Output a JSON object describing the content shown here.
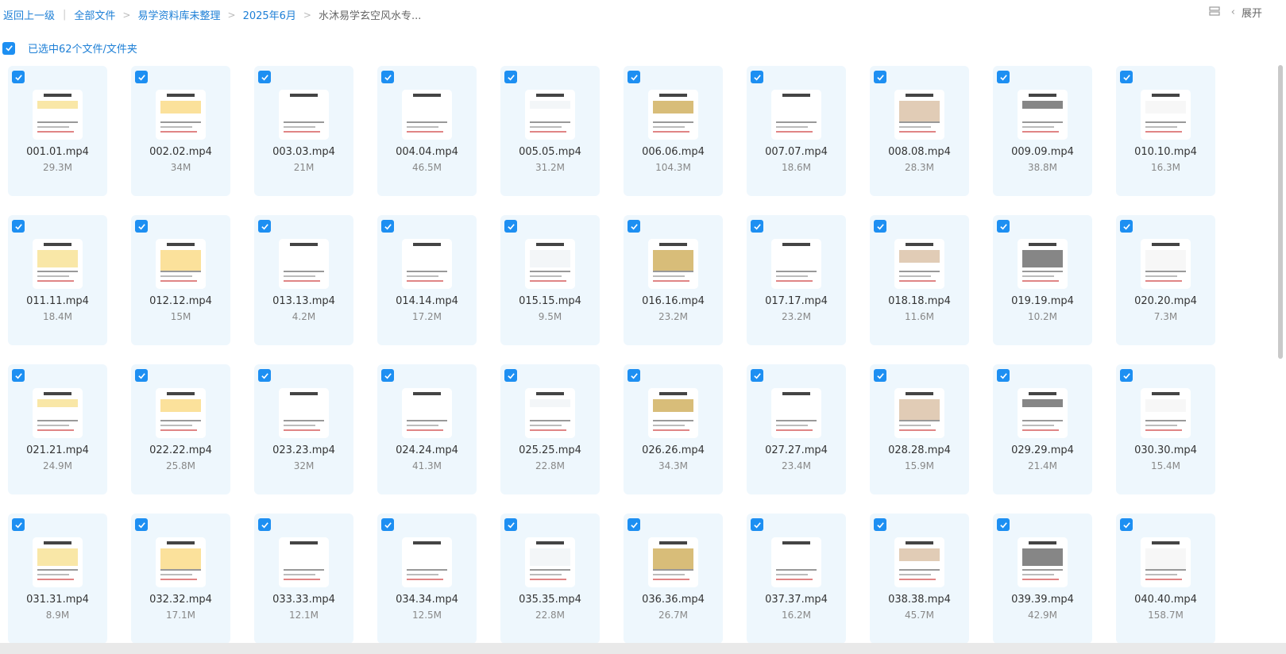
{
  "breadcrumb": {
    "back": "返回上一级",
    "items": [
      "全部文件",
      "易学资料库未整理",
      "2025年6月",
      "水沐易学玄空风水专..."
    ]
  },
  "toolbar": {
    "expand_label": "展开"
  },
  "selection": {
    "text": "已选中62个文件/文件夹"
  },
  "files": [
    {
      "name": "001.01.mp4",
      "size": "29.3M"
    },
    {
      "name": "002.02.mp4",
      "size": "34M"
    },
    {
      "name": "003.03.mp4",
      "size": "21M"
    },
    {
      "name": "004.04.mp4",
      "size": "46.5M"
    },
    {
      "name": "005.05.mp4",
      "size": "31.2M"
    },
    {
      "name": "006.06.mp4",
      "size": "104.3M"
    },
    {
      "name": "007.07.mp4",
      "size": "18.6M"
    },
    {
      "name": "008.08.mp4",
      "size": "28.3M"
    },
    {
      "name": "009.09.mp4",
      "size": "38.8M"
    },
    {
      "name": "010.10.mp4",
      "size": "16.3M"
    },
    {
      "name": "011.11.mp4",
      "size": "18.4M"
    },
    {
      "name": "012.12.mp4",
      "size": "15M"
    },
    {
      "name": "013.13.mp4",
      "size": "4.2M"
    },
    {
      "name": "014.14.mp4",
      "size": "17.2M"
    },
    {
      "name": "015.15.mp4",
      "size": "9.5M"
    },
    {
      "name": "016.16.mp4",
      "size": "23.2M"
    },
    {
      "name": "017.17.mp4",
      "size": "23.2M"
    },
    {
      "name": "018.18.mp4",
      "size": "11.6M"
    },
    {
      "name": "019.19.mp4",
      "size": "10.2M"
    },
    {
      "name": "020.20.mp4",
      "size": "7.3M"
    },
    {
      "name": "021.21.mp4",
      "size": "24.9M"
    },
    {
      "name": "022.22.mp4",
      "size": "25.8M"
    },
    {
      "name": "023.23.mp4",
      "size": "32M"
    },
    {
      "name": "024.24.mp4",
      "size": "41.3M"
    },
    {
      "name": "025.25.mp4",
      "size": "22.8M"
    },
    {
      "name": "026.26.mp4",
      "size": "34.3M"
    },
    {
      "name": "027.27.mp4",
      "size": "23.4M"
    },
    {
      "name": "028.28.mp4",
      "size": "15.9M"
    },
    {
      "name": "029.29.mp4",
      "size": "21.4M"
    },
    {
      "name": "030.30.mp4",
      "size": "15.4M"
    },
    {
      "name": "031.31.mp4",
      "size": "8.9M"
    },
    {
      "name": "032.32.mp4",
      "size": "17.1M"
    },
    {
      "name": "033.33.mp4",
      "size": "12.1M"
    },
    {
      "name": "034.34.mp4",
      "size": "12.5M"
    },
    {
      "name": "035.35.mp4",
      "size": "22.8M"
    },
    {
      "name": "036.36.mp4",
      "size": "26.7M"
    },
    {
      "name": "037.37.mp4",
      "size": "16.2M"
    },
    {
      "name": "038.38.mp4",
      "size": "45.7M"
    },
    {
      "name": "039.39.mp4",
      "size": "42.9M"
    },
    {
      "name": "040.40.mp4",
      "size": "158.7M"
    }
  ],
  "colors": {
    "accent": "#1d8ff2",
    "card_bg": "#eef7fd",
    "link": "#1d7fd6"
  }
}
